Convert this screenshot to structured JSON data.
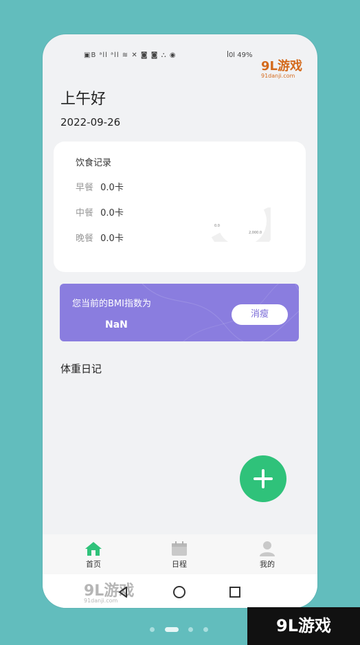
{
  "status_bar": {
    "left_icons": "▣B ᵃll ᵃll ≋ ✕ ◙ ◙ ⛬ ◉",
    "right_text": "ꟾ0l 49%"
  },
  "watermark": {
    "top_brand": "9L游戏",
    "top_url": "91danji.com",
    "bottom_brand": "9L游戏",
    "bottom_url": "91danji.com",
    "corner_brand": "9L游戏"
  },
  "header": {
    "greeting": "上午好",
    "date": "2022-09-26"
  },
  "diet_card": {
    "title": "饮食记录",
    "meals": [
      {
        "label": "早餐",
        "value": "0.0卡"
      },
      {
        "label": "中餐",
        "value": "0.0卡"
      },
      {
        "label": "晚餐",
        "value": "0.0卡"
      }
    ],
    "gauge_min": "0.0",
    "gauge_max": "2,000.0"
  },
  "bmi_card": {
    "label": "您当前的BMI指数为",
    "value": "NaN",
    "button": "消瘦"
  },
  "weight_section": {
    "title": "体重日记"
  },
  "tabs": [
    {
      "label": "首页",
      "icon": "home-icon",
      "active": true
    },
    {
      "label": "日程",
      "icon": "calendar-icon",
      "active": false
    },
    {
      "label": "我的",
      "icon": "user-icon",
      "active": false
    }
  ],
  "colors": {
    "accent_purple": "#8a7ddf",
    "fab_green": "#2fc27a",
    "active_tab_green": "#2fc27a",
    "background": "#62bdbd"
  }
}
